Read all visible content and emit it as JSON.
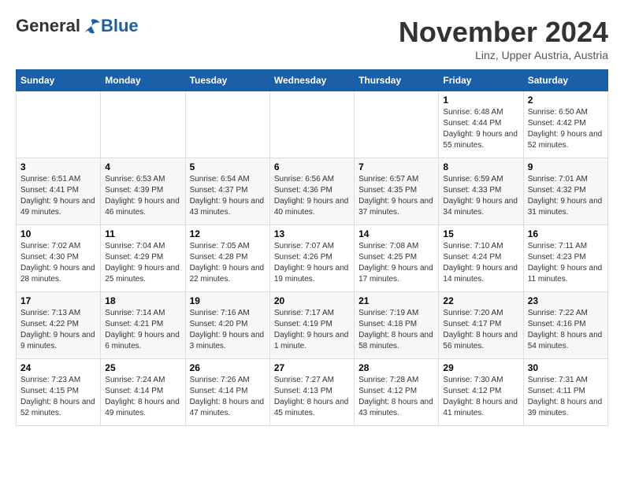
{
  "logo": {
    "general": "General",
    "blue": "Blue"
  },
  "title": "November 2024",
  "subtitle": "Linz, Upper Austria, Austria",
  "headers": [
    "Sunday",
    "Monday",
    "Tuesday",
    "Wednesday",
    "Thursday",
    "Friday",
    "Saturday"
  ],
  "weeks": [
    [
      {
        "day": "",
        "info": ""
      },
      {
        "day": "",
        "info": ""
      },
      {
        "day": "",
        "info": ""
      },
      {
        "day": "",
        "info": ""
      },
      {
        "day": "",
        "info": ""
      },
      {
        "day": "1",
        "info": "Sunrise: 6:48 AM\nSunset: 4:44 PM\nDaylight: 9 hours and 55 minutes."
      },
      {
        "day": "2",
        "info": "Sunrise: 6:50 AM\nSunset: 4:42 PM\nDaylight: 9 hours and 52 minutes."
      }
    ],
    [
      {
        "day": "3",
        "info": "Sunrise: 6:51 AM\nSunset: 4:41 PM\nDaylight: 9 hours and 49 minutes."
      },
      {
        "day": "4",
        "info": "Sunrise: 6:53 AM\nSunset: 4:39 PM\nDaylight: 9 hours and 46 minutes."
      },
      {
        "day": "5",
        "info": "Sunrise: 6:54 AM\nSunset: 4:37 PM\nDaylight: 9 hours and 43 minutes."
      },
      {
        "day": "6",
        "info": "Sunrise: 6:56 AM\nSunset: 4:36 PM\nDaylight: 9 hours and 40 minutes."
      },
      {
        "day": "7",
        "info": "Sunrise: 6:57 AM\nSunset: 4:35 PM\nDaylight: 9 hours and 37 minutes."
      },
      {
        "day": "8",
        "info": "Sunrise: 6:59 AM\nSunset: 4:33 PM\nDaylight: 9 hours and 34 minutes."
      },
      {
        "day": "9",
        "info": "Sunrise: 7:01 AM\nSunset: 4:32 PM\nDaylight: 9 hours and 31 minutes."
      }
    ],
    [
      {
        "day": "10",
        "info": "Sunrise: 7:02 AM\nSunset: 4:30 PM\nDaylight: 9 hours and 28 minutes."
      },
      {
        "day": "11",
        "info": "Sunrise: 7:04 AM\nSunset: 4:29 PM\nDaylight: 9 hours and 25 minutes."
      },
      {
        "day": "12",
        "info": "Sunrise: 7:05 AM\nSunset: 4:28 PM\nDaylight: 9 hours and 22 minutes."
      },
      {
        "day": "13",
        "info": "Sunrise: 7:07 AM\nSunset: 4:26 PM\nDaylight: 9 hours and 19 minutes."
      },
      {
        "day": "14",
        "info": "Sunrise: 7:08 AM\nSunset: 4:25 PM\nDaylight: 9 hours and 17 minutes."
      },
      {
        "day": "15",
        "info": "Sunrise: 7:10 AM\nSunset: 4:24 PM\nDaylight: 9 hours and 14 minutes."
      },
      {
        "day": "16",
        "info": "Sunrise: 7:11 AM\nSunset: 4:23 PM\nDaylight: 9 hours and 11 minutes."
      }
    ],
    [
      {
        "day": "17",
        "info": "Sunrise: 7:13 AM\nSunset: 4:22 PM\nDaylight: 9 hours and 9 minutes."
      },
      {
        "day": "18",
        "info": "Sunrise: 7:14 AM\nSunset: 4:21 PM\nDaylight: 9 hours and 6 minutes."
      },
      {
        "day": "19",
        "info": "Sunrise: 7:16 AM\nSunset: 4:20 PM\nDaylight: 9 hours and 3 minutes."
      },
      {
        "day": "20",
        "info": "Sunrise: 7:17 AM\nSunset: 4:19 PM\nDaylight: 9 hours and 1 minute."
      },
      {
        "day": "21",
        "info": "Sunrise: 7:19 AM\nSunset: 4:18 PM\nDaylight: 8 hours and 58 minutes."
      },
      {
        "day": "22",
        "info": "Sunrise: 7:20 AM\nSunset: 4:17 PM\nDaylight: 8 hours and 56 minutes."
      },
      {
        "day": "23",
        "info": "Sunrise: 7:22 AM\nSunset: 4:16 PM\nDaylight: 8 hours and 54 minutes."
      }
    ],
    [
      {
        "day": "24",
        "info": "Sunrise: 7:23 AM\nSunset: 4:15 PM\nDaylight: 8 hours and 52 minutes."
      },
      {
        "day": "25",
        "info": "Sunrise: 7:24 AM\nSunset: 4:14 PM\nDaylight: 8 hours and 49 minutes."
      },
      {
        "day": "26",
        "info": "Sunrise: 7:26 AM\nSunset: 4:14 PM\nDaylight: 8 hours and 47 minutes."
      },
      {
        "day": "27",
        "info": "Sunrise: 7:27 AM\nSunset: 4:13 PM\nDaylight: 8 hours and 45 minutes."
      },
      {
        "day": "28",
        "info": "Sunrise: 7:28 AM\nSunset: 4:12 PM\nDaylight: 8 hours and 43 minutes."
      },
      {
        "day": "29",
        "info": "Sunrise: 7:30 AM\nSunset: 4:12 PM\nDaylight: 8 hours and 41 minutes."
      },
      {
        "day": "30",
        "info": "Sunrise: 7:31 AM\nSunset: 4:11 PM\nDaylight: 8 hours and 39 minutes."
      }
    ]
  ]
}
